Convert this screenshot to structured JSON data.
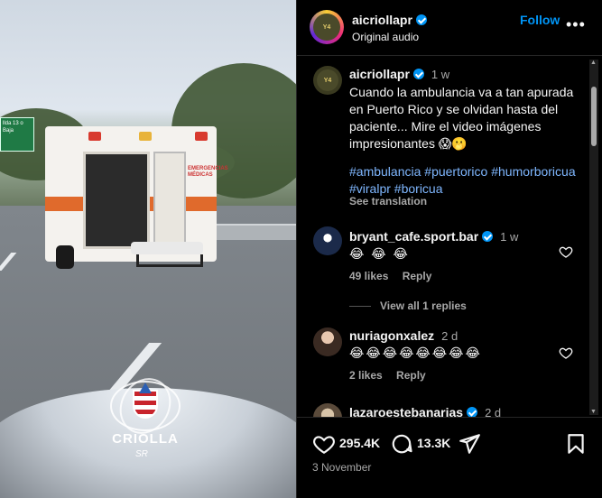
{
  "header": {
    "username": "aicriollapr",
    "audio": "Original audio",
    "follow_label": "Follow",
    "more_label": "•••"
  },
  "caption": {
    "username": "aicriollapr",
    "time": "1 w",
    "text": "Cuando la ambulancia va a tan apurada en Puerto Rico y se olvidan hasta del paciente... Mire el video imágenes impresionantes 😱🫢",
    "hashtags": [
      "#ambulancia",
      "#puertorico",
      "#humorboricua",
      "#viralpr",
      "#boricua"
    ],
    "see_translation": "See translation"
  },
  "comments": [
    {
      "username": "bryant_cafe.sport.bar",
      "verified": true,
      "time": "1 w",
      "text": "😂 😂 😂",
      "likes": "49 likes",
      "reply": "Reply",
      "view_replies": "View all 1 replies"
    },
    {
      "username": "nuriagonxalez",
      "verified": false,
      "time": "2 d",
      "text": "😂😂😂😂😂😂😂😂",
      "likes": "2 likes",
      "reply": "Reply"
    },
    {
      "username": "lazaroestebanarias",
      "verified": true,
      "time": "2 d"
    }
  ],
  "footer": {
    "like_count": "295.4K",
    "comment_count": "13.3K",
    "date": "3 November"
  },
  "video": {
    "watermark_text": "CRIOLLA",
    "signature": "SR",
    "road_sign": "llda 13 o Baja",
    "ambulance_text": "EMERGENCIAS MÉDICAS"
  },
  "colors": {
    "background": "#000000",
    "text": "#f5f5f5",
    "muted": "#a8a8a8",
    "link": "#0095f6",
    "hashtag": "#7fb7ff",
    "divider": "#262626"
  }
}
